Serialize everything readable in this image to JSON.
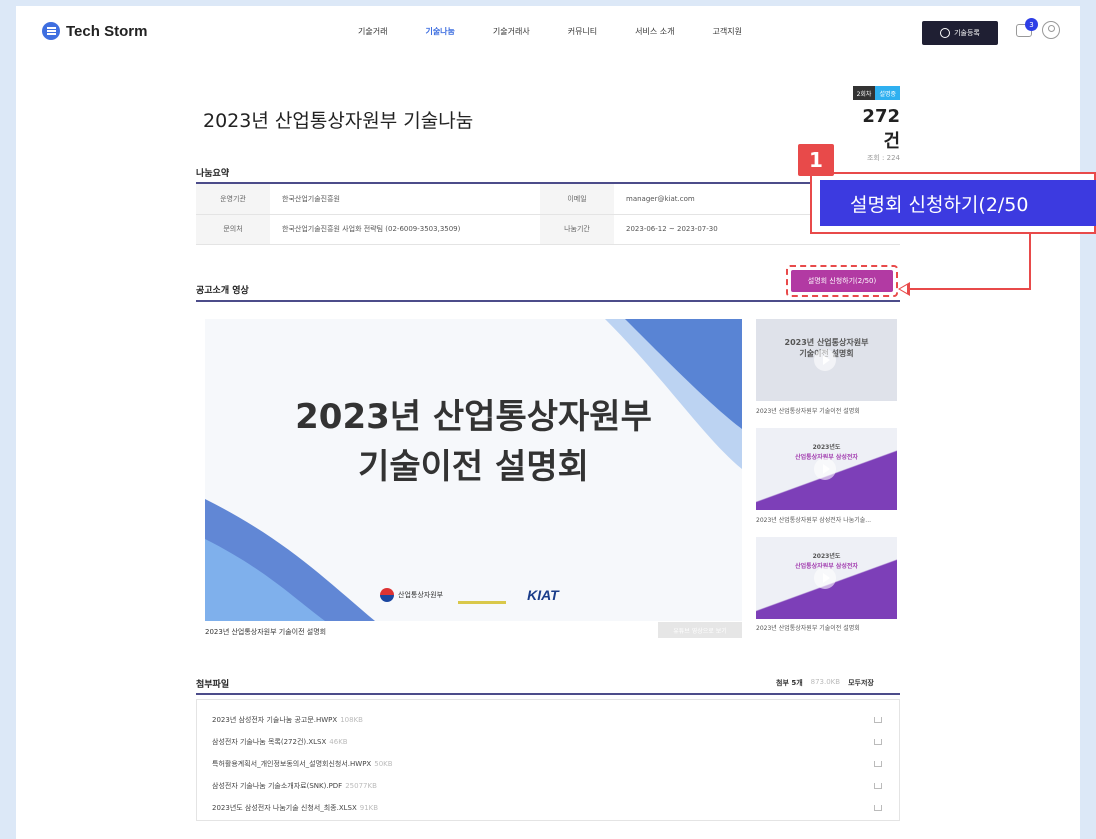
{
  "header": {
    "logo_text": "Tech Storm",
    "nav": [
      "기술거래",
      "기술나눔",
      "기술거래사",
      "커뮤니티",
      "서비스 소개",
      "고객지원"
    ],
    "register_label": "기술등록",
    "chat_badge": "3"
  },
  "title": "2023년 산업통상자원부 기술나눔",
  "stats": {
    "round": "2회차",
    "status": "설명중",
    "count": "272건",
    "views": "조회 : 224"
  },
  "summary": {
    "label": "나눔요약",
    "org_label": "운영기관",
    "org_value": "한국산업기술진흥원",
    "email_label": "이메일",
    "email_value": "manager@kiat.com",
    "contact_label": "문의처",
    "contact_value": "한국산업기술진흥원 사업화 전략팀 (02-6009-3503,3509)",
    "period_label": "나눔기간",
    "period_value": "2023-06-12 ~ 2023-07-30"
  },
  "apply_button": "설명회 신청하기(2/50)",
  "video": {
    "label": "공고소개 영상",
    "title_line1": "2023년 산업통상자원부",
    "title_line2": "기술이전 설명회",
    "org_logo_text": "산업통상자원부",
    "kiat_text": "KIAT",
    "caption": "2023년 산업통상자원부 기술이전 설명회",
    "share_button": "유튜브 영상으로 보기"
  },
  "thumbnails": [
    {
      "text_line1": "2023년 산업통상자원부",
      "text_line2": "기술이전 설명회",
      "caption": "2023년 산업통상자원부 기술이전 설명회"
    },
    {
      "text_line1": "2023년도",
      "text_line2": "산업통상자원부 삼성전자",
      "caption": "2023년 산업통상자원부 삼성전자 나눔기술..."
    },
    {
      "text_line1": "2023년도",
      "text_line2": "산업통상자원부 삼성전자",
      "caption": "2023년 산업통상자원부 기술이전 설명회"
    }
  ],
  "attachments": {
    "label": "첨부파일",
    "count": "첨부 5개",
    "total_size": "873.0KB",
    "download_all": "모두저장",
    "files": [
      {
        "name": "2023년 삼성전자 기술나눔 공고문.HWPX",
        "size": "108KB"
      },
      {
        "name": "삼성전자 기술나눔 목록(272건).XLSX",
        "size": "46KB"
      },
      {
        "name": "특허활용계획서_개인정보동의서_설명회신청서.HWPX",
        "size": "50KB"
      },
      {
        "name": "삼성전자 기술나눔 기술소개자료(SNK).PDF",
        "size": "25077KB"
      },
      {
        "name": "2023년도 삼성전자 나눔기술 신청서_최종.XLSX",
        "size": "91KB"
      }
    ]
  },
  "callout": {
    "number": "1",
    "text": "설명회 신청하기(2/50"
  },
  "colors": {
    "primary": "#3f6fe0",
    "apply": "#b23aa3",
    "callout": "#3c3ae0",
    "highlight": "#e84a4a"
  }
}
